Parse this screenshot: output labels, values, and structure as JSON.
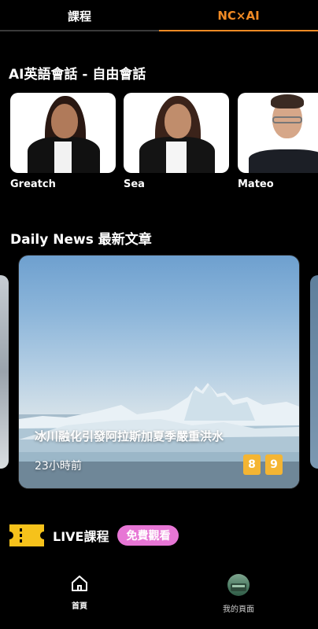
{
  "top_tabs": {
    "courses": "課程",
    "ncai": "NC×AI"
  },
  "sections": {
    "ai_title": "AI英語會話 - 自由會話",
    "news_title": "Daily News 最新文章"
  },
  "tutors": [
    {
      "name": "Greatch"
    },
    {
      "name": "Sea"
    },
    {
      "name": "Mateo"
    }
  ],
  "news": {
    "title": "冰川融化引發阿拉斯加夏季嚴重洪水",
    "time": "23小時前",
    "levels": [
      "8",
      "9"
    ]
  },
  "live": {
    "label": "LIVE課程",
    "badge": "免費觀看"
  },
  "bottom_nav": {
    "home": "首頁",
    "profile": "我的頁面"
  },
  "colors": {
    "accent": "#f08a24",
    "level_badge": "#f4b533",
    "free_badge": "#e776d5",
    "ticket": "#f6c21b"
  }
}
